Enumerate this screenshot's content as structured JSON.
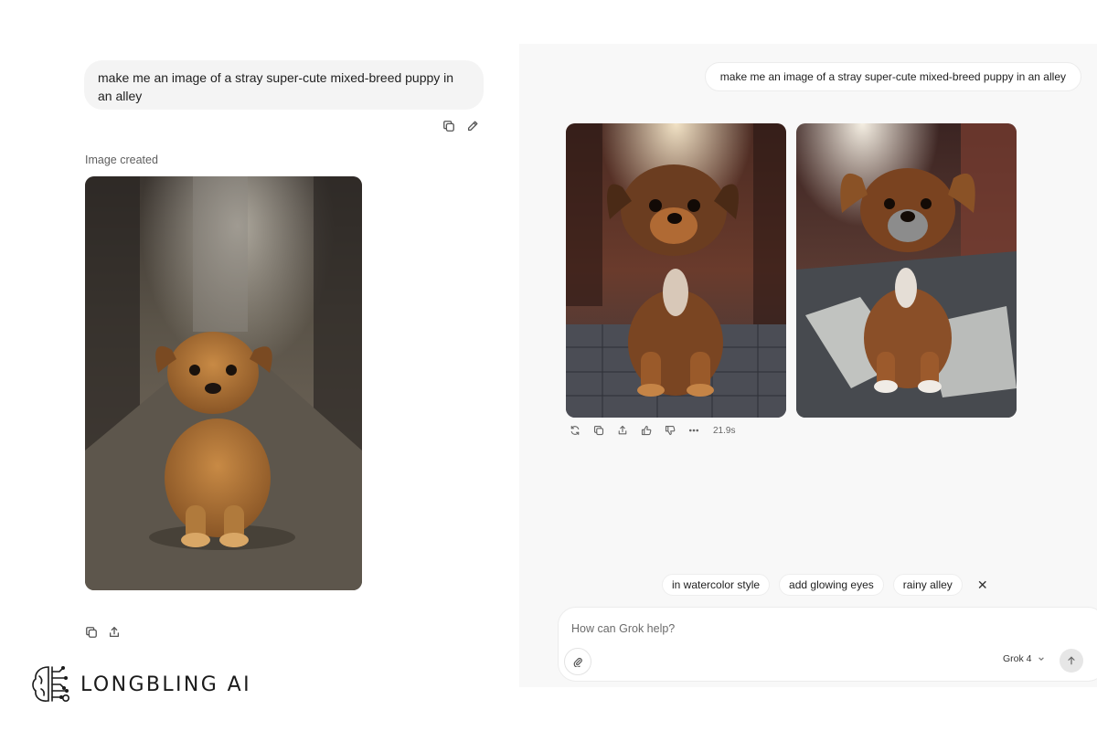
{
  "left": {
    "prompt": "make me an image of a stray super-cute mixed-breed puppy in an alley",
    "image_created_label": "Image created"
  },
  "brand": {
    "name": "LONGBLING AI"
  },
  "right": {
    "prompt": "make me an image of a stray super-cute mixed-breed puppy in an alley",
    "response_time": "21.9s",
    "suggestions": [
      "in watercolor style",
      "add glowing eyes",
      "rainy alley"
    ],
    "composer": {
      "placeholder": "How can Grok help?",
      "model": "Grok 4"
    }
  },
  "icons": [
    "copy-icon",
    "edit-icon",
    "share-icon",
    "regenerate-icon",
    "thumbs-up-icon",
    "thumbs-down-icon",
    "more-icon",
    "attach-icon",
    "chevron-down-icon",
    "arrow-up-icon",
    "close-icon",
    "brain-logo-icon"
  ]
}
